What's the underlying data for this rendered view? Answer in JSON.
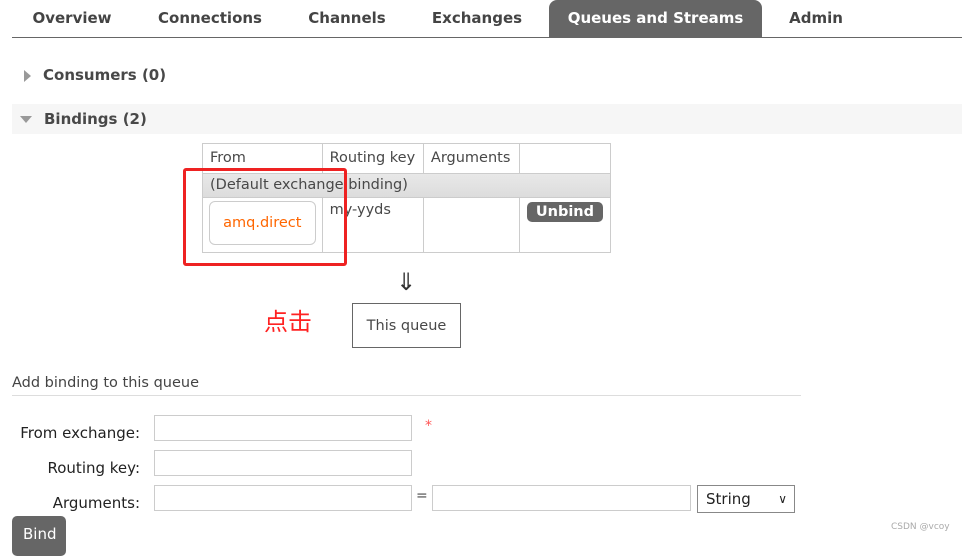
{
  "tabs": [
    "Overview",
    "Connections",
    "Channels",
    "Exchanges",
    "Queues and Streams",
    "Admin"
  ],
  "active_tab": "Queues and Streams",
  "consumers": "Consumers (0)",
  "bindings": "Bindings (2)",
  "table": {
    "headers": [
      "From",
      "Routing key",
      "Arguments",
      ""
    ],
    "default_row": "(Default exchange binding)",
    "row": {
      "from": "amq.direct",
      "routing_key": "my-yyds",
      "arguments": "",
      "action": "Unbind"
    }
  },
  "arrow": "⇓",
  "this_queue": "This queue",
  "annotation": "点击",
  "form": {
    "title": "Add binding to this queue",
    "from_exchange": "From exchange:",
    "routing_key": "Routing key:",
    "arguments": "Arguments:",
    "required": "*",
    "equals": "=",
    "type_select": "String",
    "bind": "Bind"
  },
  "watermark": "CSDN @vcoy",
  "colors": {
    "accent": "#ff6600",
    "annotation": "#ff2222",
    "tab_active": "#666666"
  }
}
